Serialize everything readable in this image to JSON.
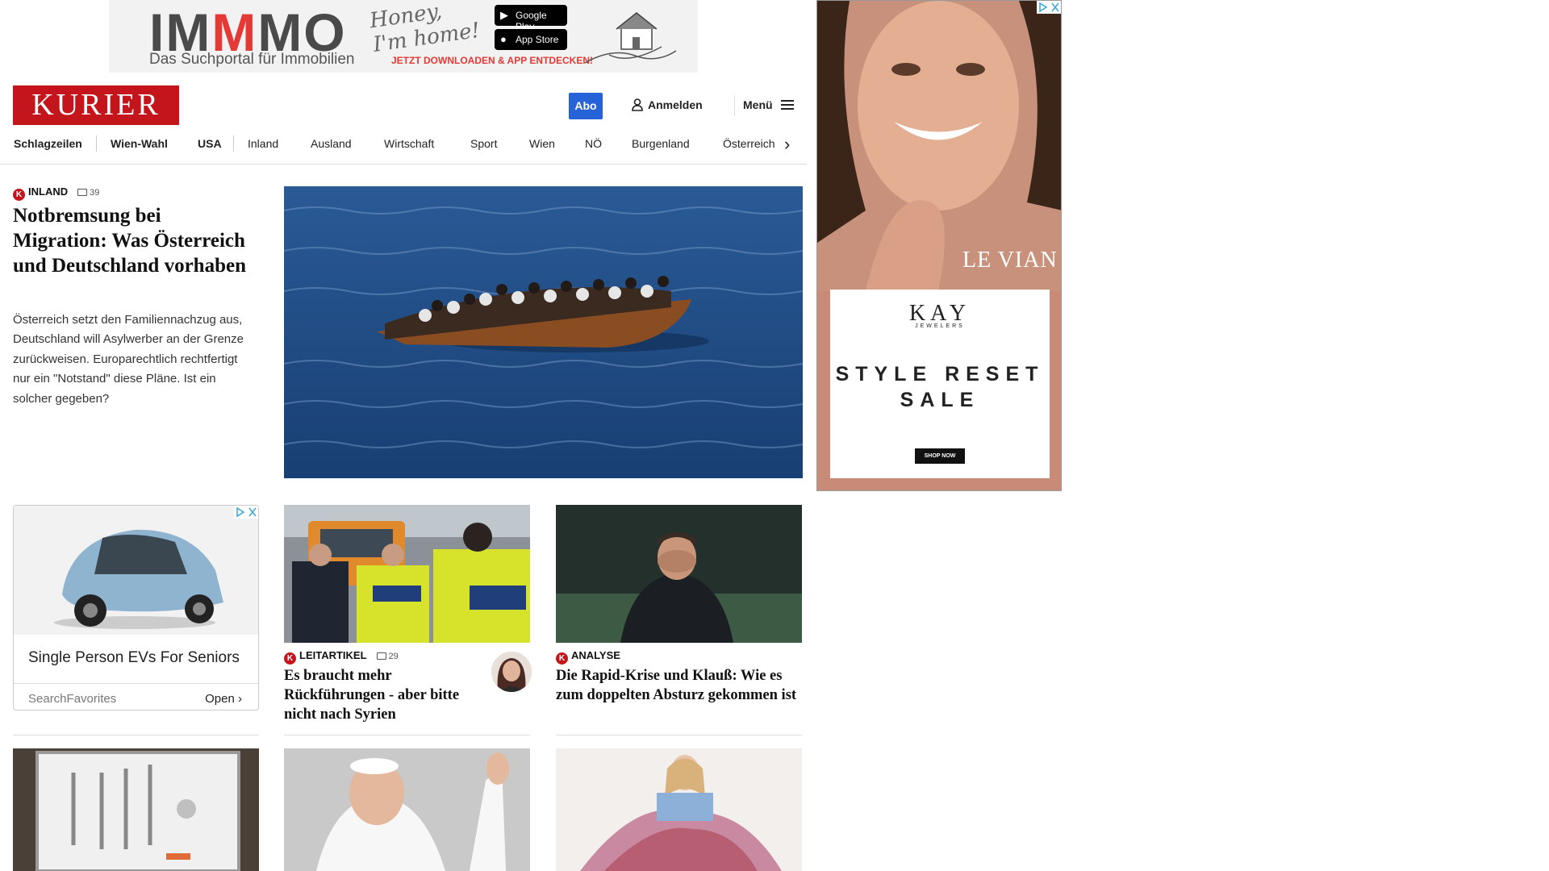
{
  "banner_ad": {
    "logo_a": "IM",
    "logo_b": "M",
    "logo_c": "MO",
    "tagline": "Das Suchportal für Immobilien",
    "handwriting_1": "Honey,",
    "handwriting_2": "I'm home!",
    "google_play": "Google Play",
    "app_store": "App Store",
    "cta": "JETZT DOWNLOADEN & APP ENTDECKEN!"
  },
  "header": {
    "logo": "KURIER",
    "abo": "Abo",
    "login": "Anmelden",
    "menu": "Menü"
  },
  "nav": {
    "items": [
      "Schlagzeilen",
      "Wien-Wahl",
      "USA",
      "Inland",
      "Ausland",
      "Wirtschaft",
      "Sport",
      "Wien",
      "NÖ",
      "Burgenland",
      "Österreich"
    ]
  },
  "lead": {
    "kicker": "INLAND",
    "comments": "39",
    "title": "Notbremsung bei Migration: Was Österreich und Deutschland vorhaben",
    "teaser": "Österreich setzt den Familiennachzug aus, Deutschland will Asylwerber an der Grenze zurückweisen. Europarechtlich rechtfertigt nur ein \"Notstand\" diese Pläne. Ist ein solcher gegeben?"
  },
  "side_ad": {
    "brand": "LE VIAN",
    "kay": "KAY",
    "jewelers": "JEWELERS",
    "sale_1": "STYLE RESET",
    "sale_2": "SALE",
    "shop": "SHOP NOW"
  },
  "ev_ad": {
    "title": "Single Person EVs For Seniors",
    "source": "SearchFavorites",
    "open": "Open"
  },
  "stories": [
    {
      "kicker": "LEITARTIKEL",
      "comments": "29",
      "title": "Es braucht mehr Rückführungen - aber bitte nicht nach Syrien"
    },
    {
      "kicker": "ANALYSE",
      "title": "Die Rapid-Krise und Klauß: Wie es zum doppelten Absturz gekommen ist"
    }
  ],
  "colors": {
    "brand_red": "#c4151c",
    "abo_blue": "#2663d6"
  }
}
